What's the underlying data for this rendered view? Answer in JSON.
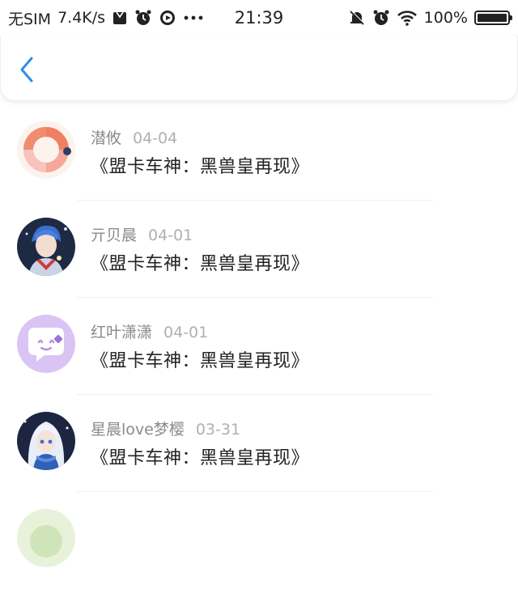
{
  "status_bar": {
    "carrier": "无SIM",
    "speed": "7.4K/s",
    "time": "21:39",
    "battery": "100%",
    "battery_level": 1.0
  },
  "nav": {
    "back_icon": "chevron-left-icon",
    "accent_color": "#2f8fe6"
  },
  "items": [
    {
      "name": "潜攸",
      "date": "04-04",
      "title": "《盟卡车神：黑兽皇再现》"
    },
    {
      "name": "亓贝晨",
      "date": "04-01",
      "title": "《盟卡车神：黑兽皇再现》"
    },
    {
      "name": "红叶潇潇",
      "date": "04-01",
      "title": "《盟卡车神：黑兽皇再现》"
    },
    {
      "name": "星晨love梦樱",
      "date": "03-31",
      "title": "《盟卡车神：黑兽皇再现》"
    },
    {
      "name": "",
      "date": "",
      "title": ""
    }
  ]
}
